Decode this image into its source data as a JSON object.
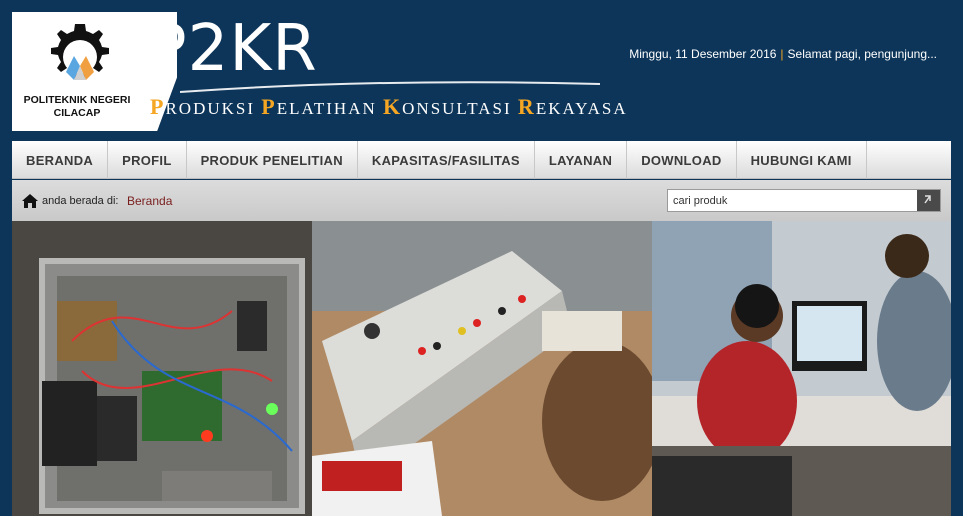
{
  "logo": {
    "line1": "POLITEKNIK NEGERI",
    "line2": "CILACAP"
  },
  "brand": {
    "title": "P2KR",
    "tagline": [
      {
        "cap": "P",
        "rest": "RODUKSI"
      },
      {
        "cap": "P",
        "rest": "ELATIHAN"
      },
      {
        "cap": "K",
        "rest": "ONSULTASI"
      },
      {
        "cap": "R",
        "rest": "EKAYASA"
      }
    ]
  },
  "header": {
    "date": "Minggu, 11 Desember 2016",
    "separator": "|",
    "greeting": "Selamat pagi, pengunjung..."
  },
  "nav": {
    "items": [
      {
        "label": "BERANDA",
        "name": "nav-beranda"
      },
      {
        "label": "PROFIL",
        "name": "nav-profil"
      },
      {
        "label": "PRODUK PENELITIAN",
        "name": "nav-produk-penelitian"
      },
      {
        "label": "KAPASITAS/FASILITAS",
        "name": "nav-kapasitas-fasilitas"
      },
      {
        "label": "LAYANAN",
        "name": "nav-layanan"
      },
      {
        "label": "DOWNLOAD",
        "name": "nav-download"
      },
      {
        "label": "HUBUNGI KAMI",
        "name": "nav-hubungi-kami"
      }
    ]
  },
  "breadcrumb": {
    "prefix": "anda berada di:",
    "current": "Beranda"
  },
  "search": {
    "placeholder": "cari produk"
  },
  "colors": {
    "header_bg": "#0d3559",
    "accent": "#f5a623",
    "link": "#7a1d1d"
  }
}
